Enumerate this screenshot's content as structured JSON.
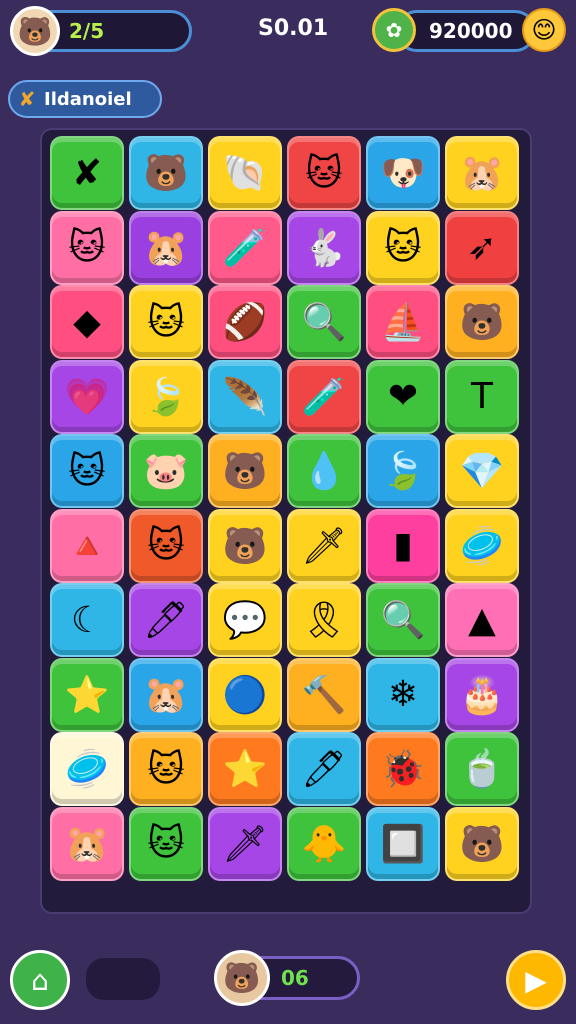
{
  "hud": {
    "progress": "2/5",
    "score": "S0.01",
    "coins": "920000",
    "avatar_icon": "🐻",
    "coin_icon": "✿",
    "smiley_icon": "😊"
  },
  "level": {
    "label": "Ildanoiel",
    "icon": "✘"
  },
  "board": {
    "rows": [
      [
        {
          "color": "#3fc23c",
          "icon": "✘"
        },
        {
          "color": "#2fb6e6",
          "icon": "🐻"
        },
        {
          "color": "#ffd21f",
          "icon": "🐚"
        },
        {
          "color": "#f04545",
          "icon": "🐱"
        },
        {
          "color": "#2aa6e8",
          "icon": "🐶"
        },
        {
          "color": "#ffd21f",
          "icon": "🐹"
        }
      ],
      [
        {
          "color": "#ff6fa5",
          "icon": "🐱"
        },
        {
          "color": "#9a3fe0",
          "icon": "🐹"
        },
        {
          "color": "#ff5a8a",
          "icon": "🧪"
        },
        {
          "color": "#a646e6",
          "icon": "🐇"
        },
        {
          "color": "#ffd21f",
          "icon": "🐱"
        },
        {
          "color": "#f04040",
          "icon": "➶"
        }
      ],
      [
        {
          "color": "#ff4f80",
          "icon": "◆"
        },
        {
          "color": "#ffd21f",
          "icon": "🐱"
        },
        {
          "color": "#ff4f7f",
          "icon": "🏈"
        },
        {
          "color": "#3fc23c",
          "icon": "🔍"
        },
        {
          "color": "#ff4f80",
          "icon": "⛵"
        },
        {
          "color": "#ffb020",
          "icon": "🐻"
        }
      ],
      [
        {
          "color": "#a646e6",
          "icon": "💗"
        },
        {
          "color": "#ffd21f",
          "icon": "🍃"
        },
        {
          "color": "#2fb6e6",
          "icon": "🪶"
        },
        {
          "color": "#f04545",
          "icon": "🧪"
        },
        {
          "color": "#3fc23c",
          "icon": "❤"
        },
        {
          "color": "#3fc23c",
          "icon": "T"
        }
      ],
      [
        {
          "color": "#2aa6e8",
          "icon": "🐱"
        },
        {
          "color": "#3fc23c",
          "icon": "🐷"
        },
        {
          "color": "#ffb020",
          "icon": "🐻"
        },
        {
          "color": "#3fc23c",
          "icon": "💧"
        },
        {
          "color": "#2aa6e8",
          "icon": "🍃"
        },
        {
          "color": "#ffd21f",
          "icon": "💎"
        }
      ],
      [
        {
          "color": "#ff6fa5",
          "icon": "🔺"
        },
        {
          "color": "#f05a2a",
          "icon": "🐱"
        },
        {
          "color": "#ffd21f",
          "icon": "🐻"
        },
        {
          "color": "#ffd21f",
          "icon": "🗡"
        },
        {
          "color": "#ff3f9f",
          "icon": "▮"
        },
        {
          "color": "#ffd21f",
          "icon": "🥏"
        }
      ],
      [
        {
          "color": "#2fb6e6",
          "icon": "☾"
        },
        {
          "color": "#a646e6",
          "icon": "🖊"
        },
        {
          "color": "#ffd21f",
          "icon": "💬"
        },
        {
          "color": "#ffd21f",
          "icon": "🎗"
        },
        {
          "color": "#3fc23c",
          "icon": "🔍"
        },
        {
          "color": "#ff6fb5",
          "icon": "▲"
        }
      ],
      [
        {
          "color": "#3fc23c",
          "icon": "⭐"
        },
        {
          "color": "#2aa6e8",
          "icon": "🐹"
        },
        {
          "color": "#ffd21f",
          "icon": "🔵"
        },
        {
          "color": "#ffb020",
          "icon": "🔨"
        },
        {
          "color": "#2fb6e6",
          "icon": "❄"
        },
        {
          "color": "#a646e6",
          "icon": "🎂"
        }
      ],
      [
        {
          "color": "#fff6d6",
          "icon": "🥏"
        },
        {
          "color": "#ffb020",
          "icon": "🐱"
        },
        {
          "color": "#ff7a1f",
          "icon": "⭐"
        },
        {
          "color": "#2fb6e6",
          "icon": "🖊"
        },
        {
          "color": "#ff7a1f",
          "icon": "🐞"
        },
        {
          "color": "#3fc23c",
          "icon": "🍵"
        }
      ],
      [
        {
          "color": "#ff6fa5",
          "icon": "🐹"
        },
        {
          "color": "#3fc23c",
          "icon": "🐱"
        },
        {
          "color": "#a646e6",
          "icon": "🗡"
        },
        {
          "color": "#3fc23c",
          "icon": "🐥"
        },
        {
          "color": "#2fb6e6",
          "icon": "🔲"
        },
        {
          "color": "#ffd21f",
          "icon": "🐻"
        }
      ]
    ]
  },
  "bottom": {
    "home_icon": "⌂",
    "moves": "06",
    "moves_avatar_icon": "🐻",
    "play_icon": "▶"
  }
}
